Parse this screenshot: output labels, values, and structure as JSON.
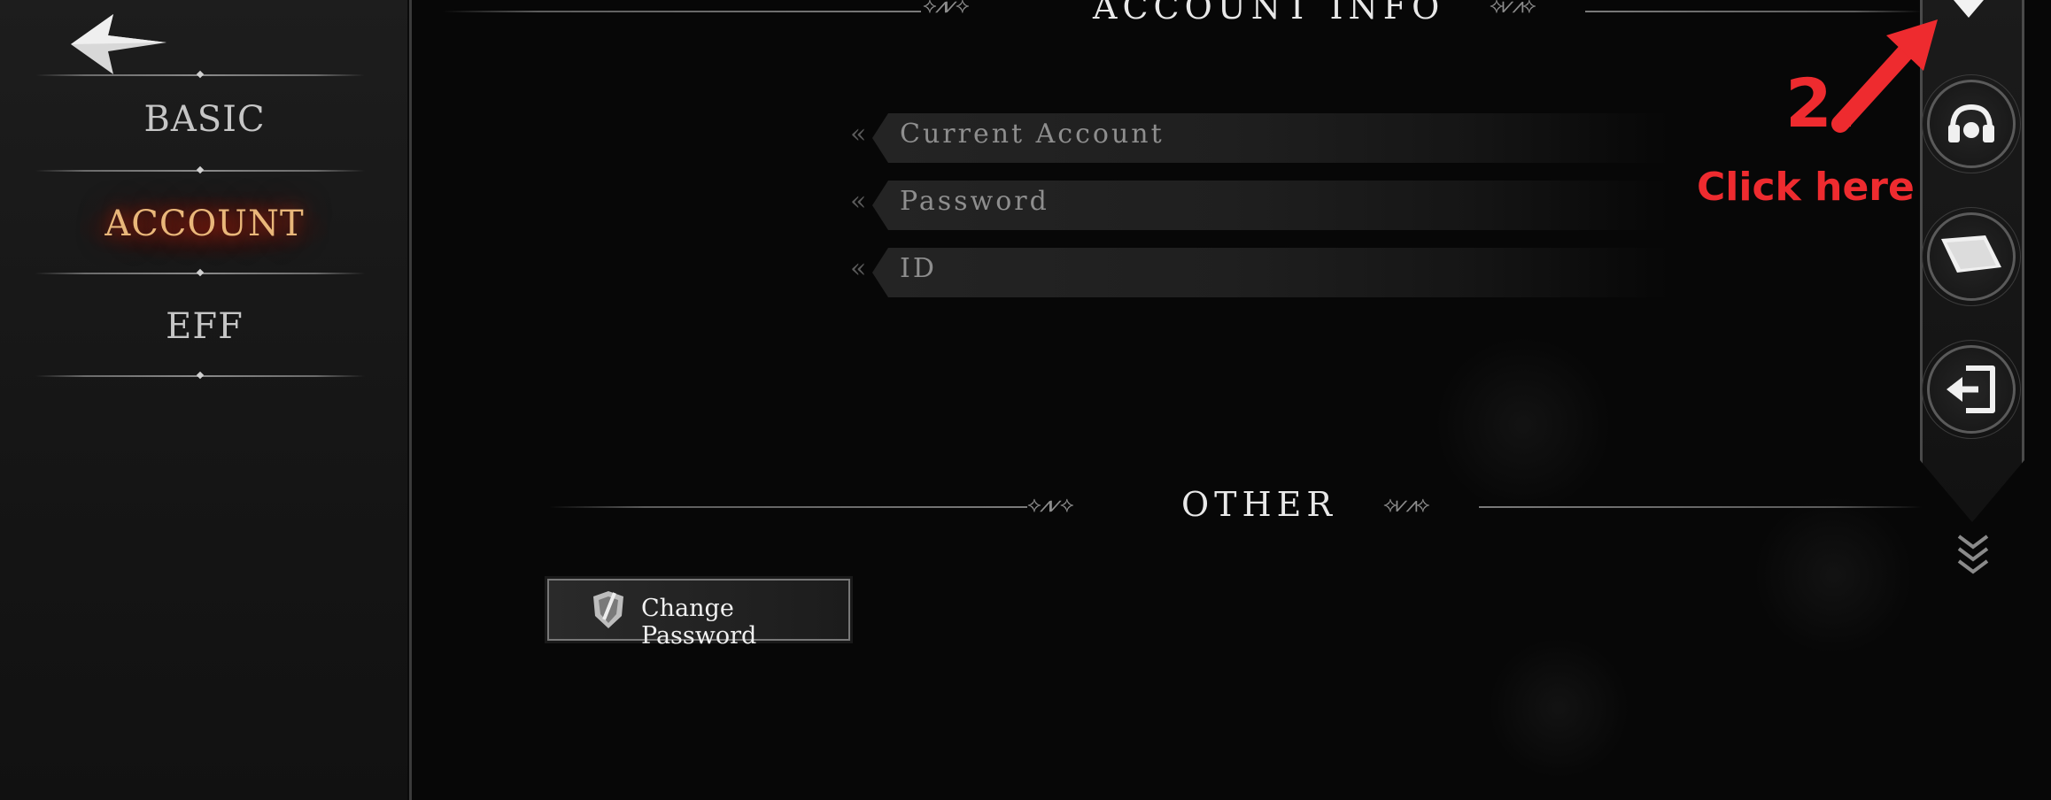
{
  "sidebar": {
    "back_icon": "back-arrow-icon",
    "items": [
      {
        "label": "BASIC",
        "active": false
      },
      {
        "label": "ACCOUNT",
        "active": true
      },
      {
        "label": "EFF",
        "active": false
      }
    ]
  },
  "account_info": {
    "title": "ACCOUNT INFO",
    "fields": [
      {
        "label": "Current Account"
      },
      {
        "label": "Password"
      },
      {
        "label": "ID"
      }
    ]
  },
  "other": {
    "title": "OTHER",
    "change_password_label": "Change Password"
  },
  "rail": {
    "buttons": [
      "headset-icon",
      "scroll-icon",
      "logout-icon"
    ]
  },
  "annotation": {
    "step": "2.",
    "text": "Click here",
    "color": "#ee2b2f"
  },
  "colors": {
    "active_nav": "#e9b77a",
    "background": "#070707"
  }
}
